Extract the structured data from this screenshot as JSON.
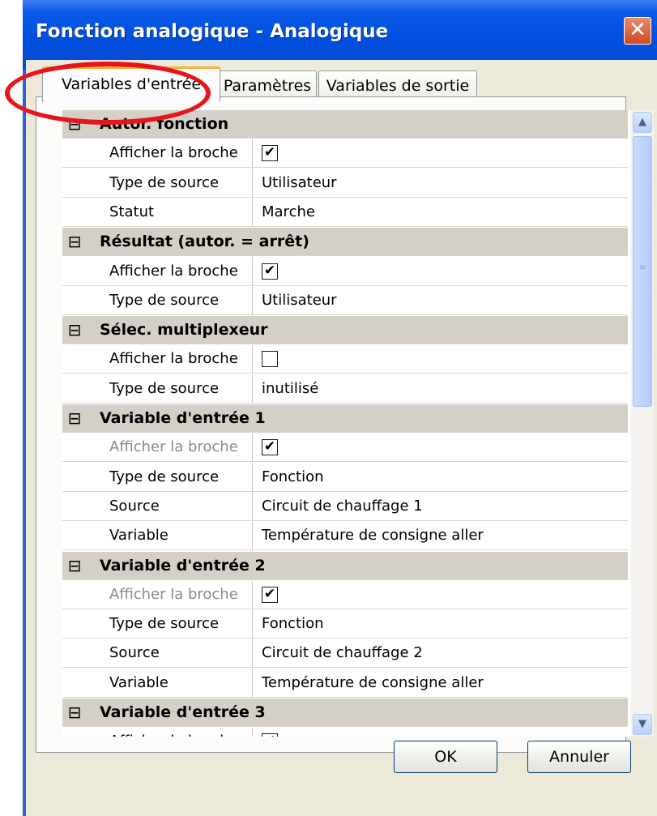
{
  "window": {
    "title": "Fonction analogique - Analogique",
    "close_glyph": "✕"
  },
  "tabs": [
    {
      "label": "Variables d'entrée",
      "active": true
    },
    {
      "label": "Paramètres",
      "active": false
    },
    {
      "label": "Variables de sortie",
      "active": false
    }
  ],
  "categories": [
    {
      "title": "Autor. fonction",
      "toggle": "⊟",
      "rows": [
        {
          "label": "Afficher la broche",
          "value": "",
          "checkbox": "✔"
        },
        {
          "label": "Type de source",
          "value": "Utilisateur"
        },
        {
          "label": "Statut",
          "value": "Marche"
        }
      ]
    },
    {
      "title": "Résultat (autor. = arrêt)",
      "toggle": "⊟",
      "rows": [
        {
          "label": "Afficher la broche",
          "value": "",
          "checkbox": "✔"
        },
        {
          "label": "Type de source",
          "value": "Utilisateur"
        }
      ]
    },
    {
      "title": "Sélec. multiplexeur",
      "toggle": "⊟",
      "rows": [
        {
          "label": "Afficher la broche",
          "value": "",
          "checkbox": ""
        },
        {
          "label": "Type de source",
          "value": "inutilisé"
        }
      ]
    },
    {
      "title": "Variable d'entrée 1",
      "toggle": "⊟",
      "rows": [
        {
          "label": "Afficher la broche",
          "value": "",
          "checkbox": "✔",
          "dim": true
        },
        {
          "label": "Type de source",
          "value": "Fonction"
        },
        {
          "label": "Source",
          "value": "Circuit de chauffage 1"
        },
        {
          "label": "Variable",
          "value": "Température de consigne aller"
        }
      ]
    },
    {
      "title": "Variable d'entrée 2",
      "toggle": "⊟",
      "rows": [
        {
          "label": "Afficher la broche",
          "value": "",
          "checkbox": "✔",
          "dim": true
        },
        {
          "label": "Type de source",
          "value": "Fonction"
        },
        {
          "label": "Source",
          "value": "Circuit de chauffage 2"
        },
        {
          "label": "Variable",
          "value": "Température de consigne aller"
        }
      ]
    },
    {
      "title": "Variable d'entrée 3",
      "toggle": "⊟",
      "rows": [
        {
          "label": "Afficher la broche",
          "value": "",
          "checkbox": "✔"
        }
      ]
    }
  ],
  "scrollbar": {
    "up": "▲",
    "down": "▼"
  },
  "buttons": {
    "ok": "OK",
    "cancel": "Annuler"
  },
  "colors": {
    "titlebar": "#0050e0",
    "annotation": "#e8141c",
    "category_bg": "#d4d0c8",
    "active_tab_accent": "#f6b33a"
  }
}
